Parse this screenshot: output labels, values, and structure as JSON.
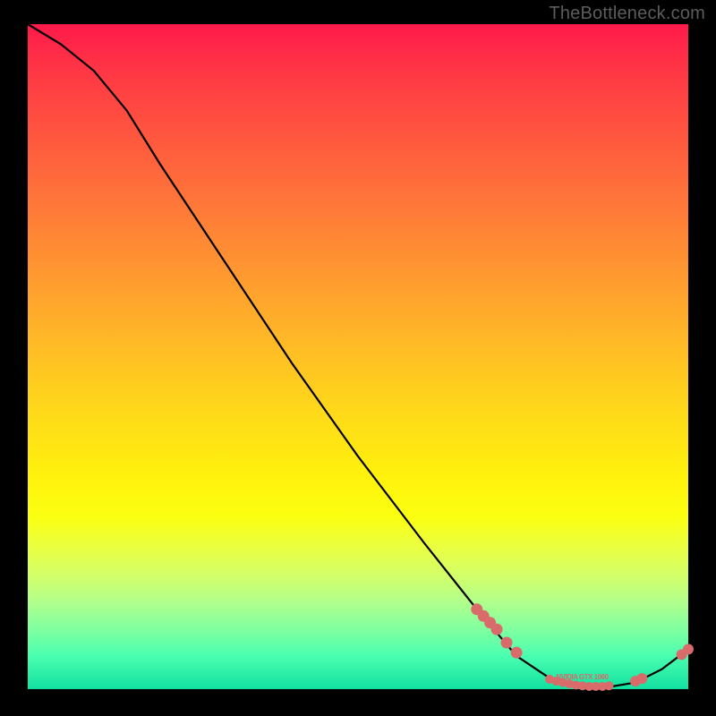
{
  "watermark": "TheBottleneck.com",
  "chart_data": {
    "type": "line",
    "title": "",
    "xlabel": "",
    "ylabel": "",
    "xlim": [
      0,
      100
    ],
    "ylim": [
      0,
      100
    ],
    "curve": [
      {
        "x": 0,
        "y": 100
      },
      {
        "x": 5,
        "y": 97
      },
      {
        "x": 10,
        "y": 93
      },
      {
        "x": 15,
        "y": 87
      },
      {
        "x": 20,
        "y": 79
      },
      {
        "x": 30,
        "y": 64
      },
      {
        "x": 40,
        "y": 49
      },
      {
        "x": 50,
        "y": 35
      },
      {
        "x": 60,
        "y": 22
      },
      {
        "x": 68,
        "y": 12
      },
      {
        "x": 74,
        "y": 5
      },
      {
        "x": 80,
        "y": 1
      },
      {
        "x": 86,
        "y": 0
      },
      {
        "x": 92,
        "y": 1
      },
      {
        "x": 96,
        "y": 3
      },
      {
        "x": 100,
        "y": 6
      }
    ],
    "markers_cluster_a": [
      {
        "x": 68,
        "y": 12
      },
      {
        "x": 69,
        "y": 11
      },
      {
        "x": 70,
        "y": 10
      },
      {
        "x": 71,
        "y": 9
      },
      {
        "x": 72.5,
        "y": 7
      },
      {
        "x": 74,
        "y": 5.5
      }
    ],
    "markers_cluster_b": [
      {
        "x": 79,
        "y": 1.5
      },
      {
        "x": 80,
        "y": 1.2
      },
      {
        "x": 81,
        "y": 1.0
      },
      {
        "x": 82,
        "y": 0.8
      },
      {
        "x": 83,
        "y": 0.6
      },
      {
        "x": 84,
        "y": 0.5
      },
      {
        "x": 85,
        "y": 0.4
      },
      {
        "x": 86,
        "y": 0.4
      },
      {
        "x": 87,
        "y": 0.4
      },
      {
        "x": 88,
        "y": 0.5
      }
    ],
    "markers_cluster_c": [
      {
        "x": 92,
        "y": 1.2
      },
      {
        "x": 93,
        "y": 1.6
      }
    ],
    "markers_cluster_d": [
      {
        "x": 99,
        "y": 5.2
      },
      {
        "x": 100,
        "y": 6.0
      }
    ],
    "marker_color": "#d96b6b",
    "curve_color": "#000000",
    "legend_label": "NVIDIA GTX 1060"
  }
}
